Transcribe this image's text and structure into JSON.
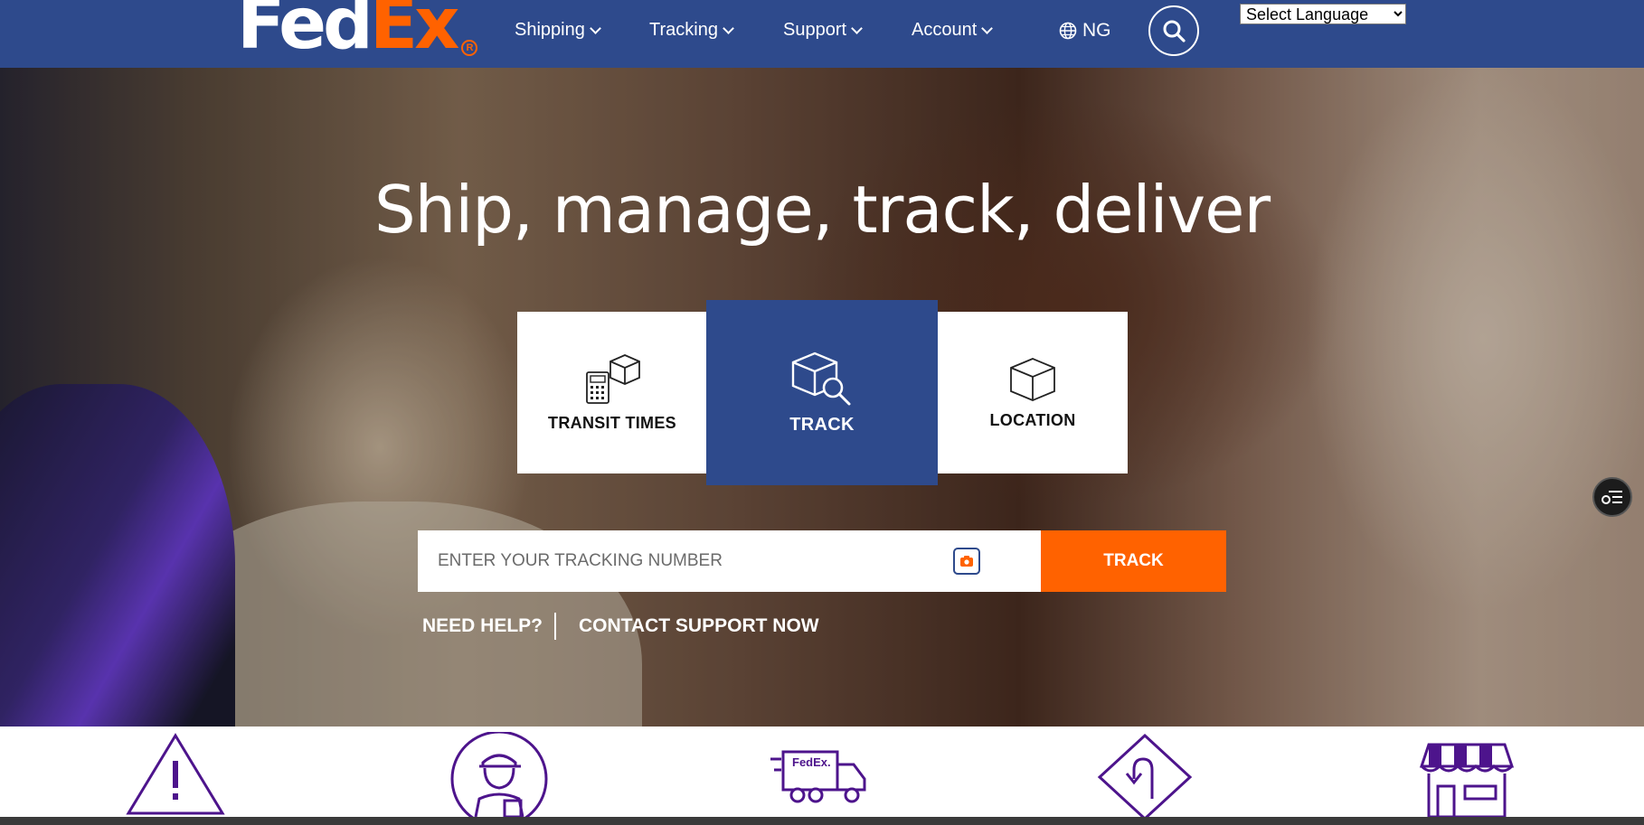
{
  "header": {
    "logo_fed": "Fed",
    "logo_ex": "Ex",
    "logo_reg": "R",
    "nav": [
      {
        "label": "Shipping"
      },
      {
        "label": "Tracking"
      },
      {
        "label": "Support"
      },
      {
        "label": "Account"
      }
    ],
    "country_code": "NG",
    "language_select": {
      "selected": "Select Language"
    },
    "colors": {
      "brand_purple": "#2e4a8c",
      "brand_orange": "#ff6200"
    }
  },
  "hero": {
    "title": "Ship, manage, track, deliver",
    "cards": [
      {
        "label": "TRANSIT TIMES",
        "icon": "calculator-box-icon"
      },
      {
        "label": "TRACK",
        "icon": "box-search-icon",
        "active": true
      },
      {
        "label": "LOCATION",
        "icon": "box-icon"
      }
    ],
    "tracking": {
      "placeholder": "ENTER YOUR TRACKING NUMBER",
      "value": "",
      "button_label": "TRACK"
    },
    "need_help": "NEED HELP?",
    "contact_support": "CONTACT SUPPORT NOW"
  },
  "bottom_icons": [
    {
      "icon": "warning-icon"
    },
    {
      "icon": "courier-person-icon"
    },
    {
      "icon": "fedex-van-icon",
      "text": "FedEx."
    },
    {
      "icon": "return-sign-icon"
    },
    {
      "icon": "store-icon"
    }
  ]
}
